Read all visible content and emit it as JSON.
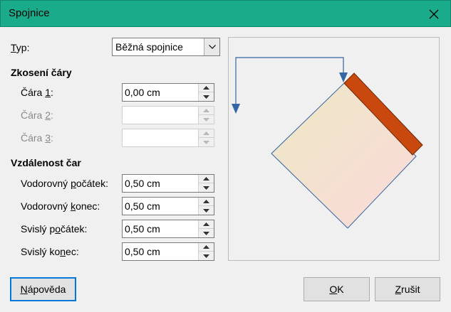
{
  "window": {
    "title": "Spojnice"
  },
  "type_row": {
    "label": "Typ:",
    "value": "Běžná spojnice"
  },
  "skew": {
    "heading": "Zkosení čáry",
    "line1": {
      "label": "Čára 1:",
      "value": "0,00 cm"
    },
    "line2": {
      "label": "Čára 2:",
      "value": ""
    },
    "line3": {
      "label": "Čára 3:",
      "value": ""
    }
  },
  "spacing": {
    "heading": "Vzdálenost čar",
    "h_start": {
      "label": "Vodorovný počátek:",
      "value": "0,50 cm"
    },
    "h_end": {
      "label": "Vodorovný konec:",
      "value": "0,50 cm"
    },
    "v_start": {
      "label": "Svislý počátek:",
      "value": "0,50 cm"
    },
    "v_end": {
      "label": "Svislý konec:",
      "value": "0,50 cm"
    }
  },
  "buttons": {
    "help": "Nápověda",
    "ok": "OK",
    "cancel": "Zrušit"
  },
  "colors": {
    "titlebar": "#1aab8a",
    "connector": "#3465a4",
    "shape_bar": "#c9480d",
    "focus_border": "#0078d7"
  },
  "icons": {
    "close": "close-icon",
    "combo": "chevron-down-icon",
    "spin_up": "spin-up-icon",
    "spin_down": "spin-down-icon"
  }
}
